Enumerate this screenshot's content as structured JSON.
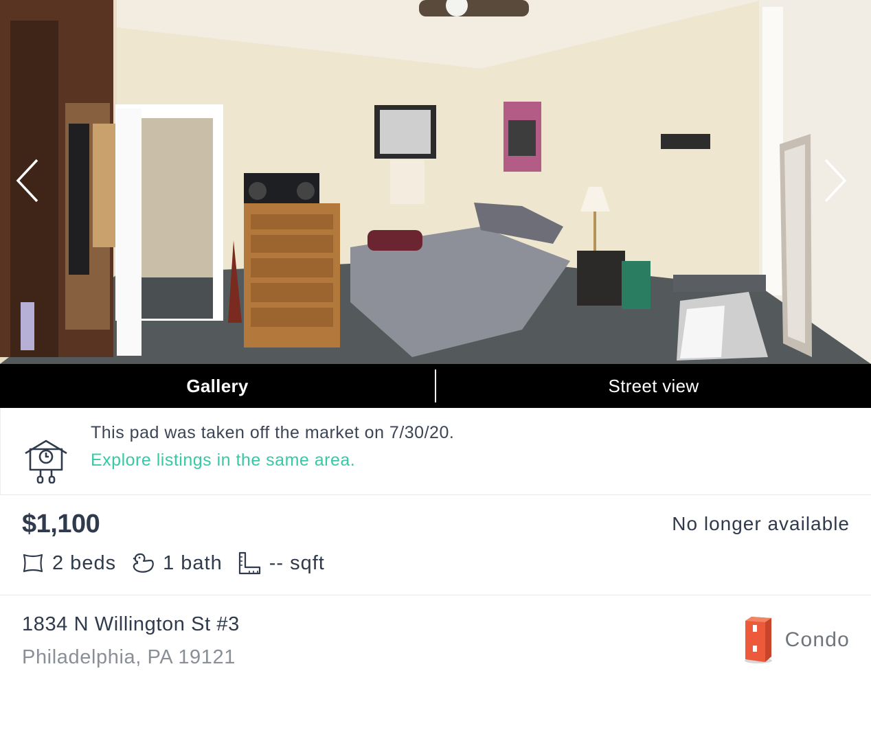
{
  "gallery": {
    "tabs": [
      {
        "label": "Gallery",
        "active": true
      },
      {
        "label": "Street view",
        "active": false
      }
    ]
  },
  "banner": {
    "message": "This pad was taken off the market on 7/30/20.",
    "link_text": "Explore listings in the same area.",
    "link_color": "#37c8a6",
    "icon": "cuckoo-clock-icon"
  },
  "listing": {
    "price": "$1,100",
    "availability": "No longer available",
    "beds": "2 beds",
    "baths": "1 bath",
    "sqft": "-- sqft",
    "address_line1": "1834 N Willington St #3",
    "address_line2": "Philadelphia, PA 19121",
    "property_type": "Condo",
    "property_type_icon": "condo-building-icon",
    "property_type_color": "#ec5a3b"
  }
}
